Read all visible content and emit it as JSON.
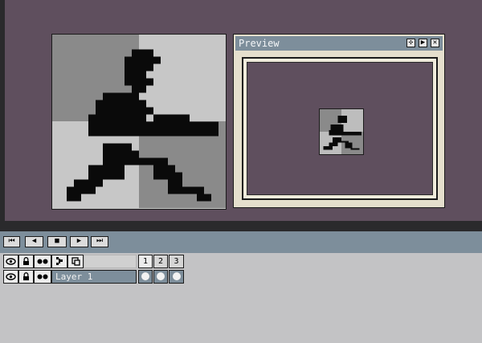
{
  "preview": {
    "title": "Preview",
    "buttons": [
      "✣",
      "▶",
      "✕"
    ]
  },
  "timeline": {
    "controls": [
      "⏮",
      "◀",
      "■",
      "▶",
      "⏭"
    ],
    "header_icons": [
      "eye-icon",
      "lock-icon",
      "onion-skin-icon",
      "link-icon",
      "reference-icon"
    ],
    "frames": [
      "1",
      "2",
      "3"
    ]
  },
  "layers": [
    {
      "name": "Layer 1",
      "cels": [
        true,
        true,
        true
      ]
    }
  ],
  "colors": {
    "workspace": "#5f4f5e",
    "panel_accent": "#7d8e9b",
    "checker_dark": "#8a8a8a",
    "checker_light": "#c7c7c7",
    "sprite": "#0a0a0a"
  }
}
